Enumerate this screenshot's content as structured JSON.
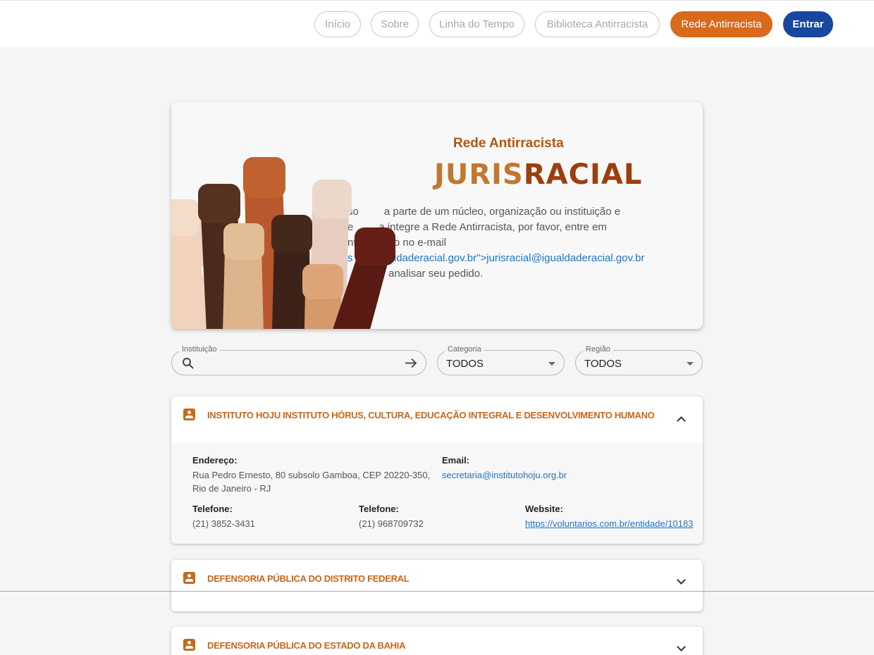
{
  "nav": {
    "items": [
      "Início",
      "Sobre",
      "Linha do Tempo",
      "Biblioteca Antirracista"
    ],
    "active": "Rede Antirracista",
    "login": "Entrar"
  },
  "hero": {
    "subtitle": "Rede Antirracista",
    "logo_part1": "JURIS",
    "logo_part2": "RACIAL",
    "text_a": "so",
    "text_b": "a parte de um núcleo, organização ou instituição e",
    "text_c": "e",
    "text_d": "a integre a Rede Antirracista, por favor, entre em",
    "text_e": "nt",
    "text_f": "osco no e-mail",
    "text_g": "s",
    "text_h": "igualdaderacial.gov.br\">",
    "email": "jurisracial@igualdaderacial.gov.br",
    "text_i": "analisar seu pedido."
  },
  "filters": {
    "institution_label": "Instituição",
    "institution_value": "",
    "category_label": "Categoria",
    "category_value": "TODOS",
    "region_label": "Região",
    "region_value": "TODOS"
  },
  "entries": [
    {
      "title": "INSTITUTO HOJU INSTITUTO HÓRUS, CULTURA, EDUCAÇÃO INTEGRAL E DESENVOLVIMENTO HUMANO",
      "address_label": "Endereço:",
      "address_line1": "Rua Pedro Ernesto, 80 subsolo Gamboa, CEP 20220-350,",
      "address_line2": "Rio de Janeiro - RJ",
      "email_label": "Email:",
      "email": "secretaria@institutohoju.org.br",
      "phone1_label": "Telefone:",
      "phone1": "(21) 3852-3431",
      "phone2_label": "Telefone:",
      "phone2": "(21) 968709732",
      "website_label": "Website:",
      "website": "https://voluntarios.com.br/entidade/10183"
    },
    {
      "title": "DEFENSORIA PÚBLICA DO DISTRITO FEDERAL"
    },
    {
      "title": "DEFENSORIA PÚBLICA DO ESTADO DA BAHIA"
    }
  ],
  "colors": {
    "accent_orange": "#d96a1c",
    "accent_blue": "#17479e",
    "link": "#1f74c8"
  }
}
